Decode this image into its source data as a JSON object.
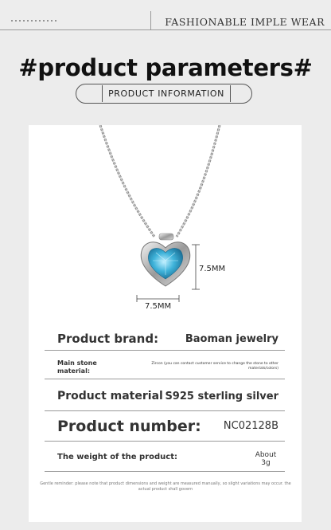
{
  "header": {
    "brand": "FASHIONABLE IMPLE WEAR"
  },
  "title": {
    "headline": "#product parameters#",
    "subtitle": "PRODUCT INFORMATION"
  },
  "product_image": {
    "width_label": "7.5MM",
    "height_label": "7.5MM",
    "stone_color": "#3fb3da"
  },
  "specs": [
    {
      "label": "Product brand:",
      "value": "Baoman jewelry"
    },
    {
      "label": "Main stone material:",
      "value": "Zircon (you can contact customer service to change the stone to other materials/colors)"
    },
    {
      "label": "Product material",
      "value": "S925 sterling silver"
    },
    {
      "label": "Product number:",
      "value": "NC02128B"
    },
    {
      "label": "The weight of the product:",
      "value": "About 3g"
    }
  ],
  "reminder": "Gentle reminder: please note that product dimensions and weight are measured manually, so slight variations may occur. the actual product shall govern"
}
